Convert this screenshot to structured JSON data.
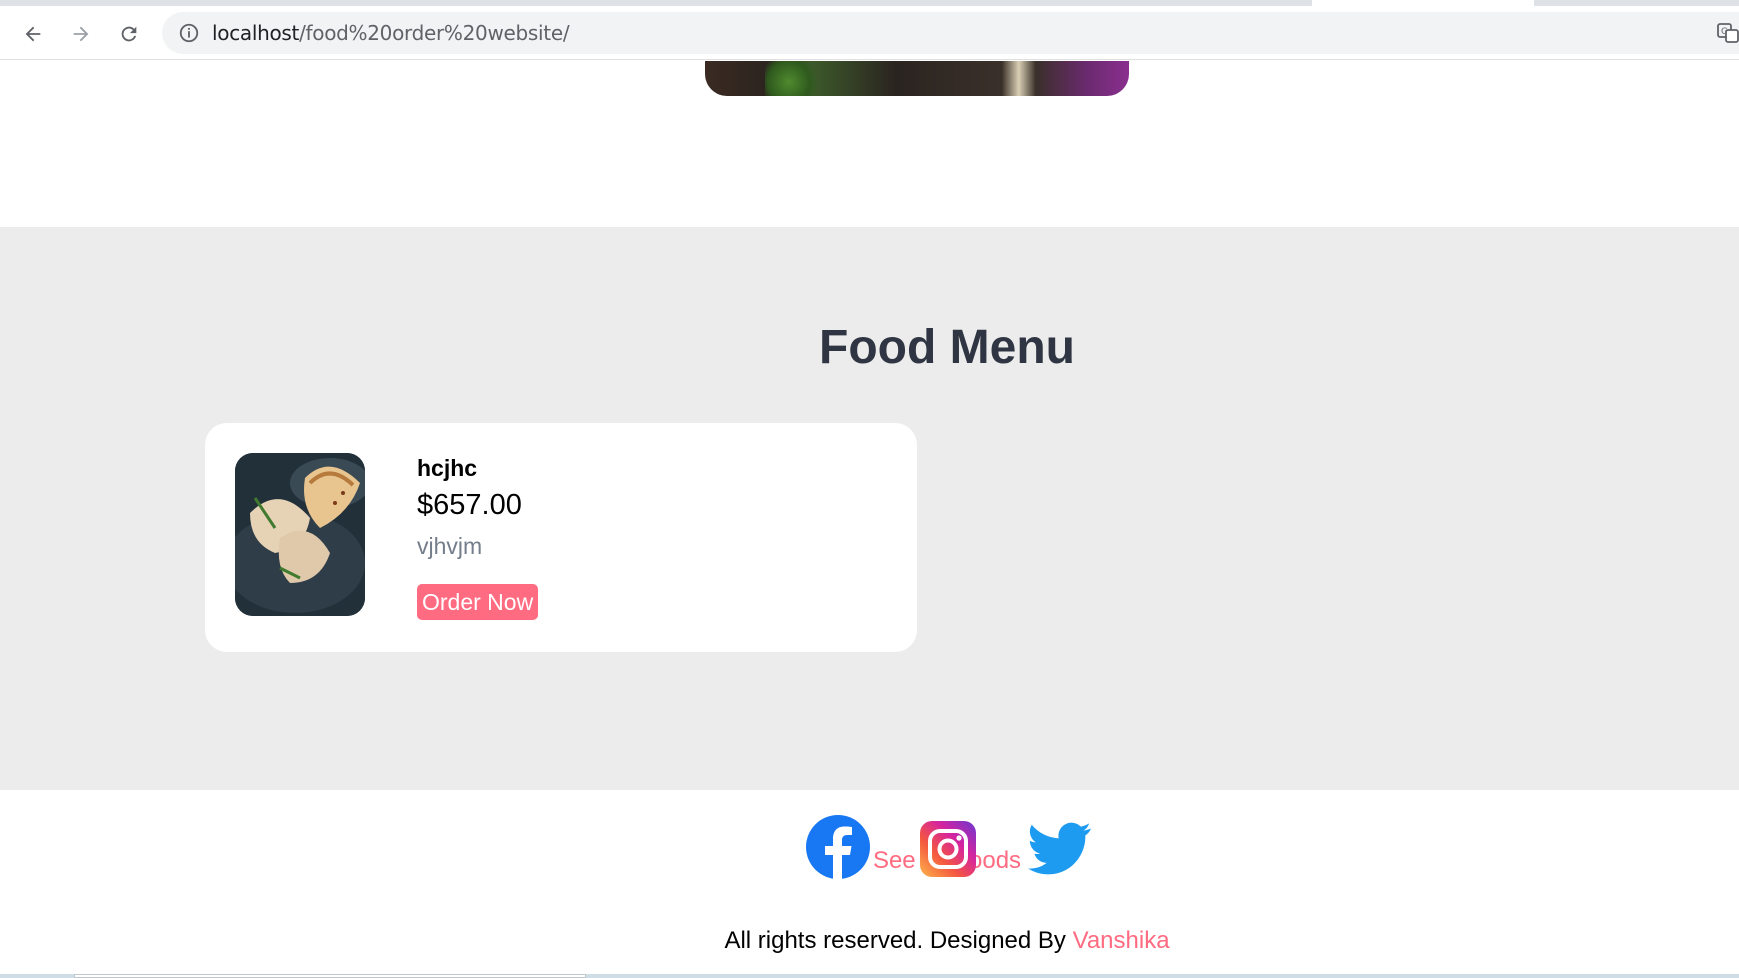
{
  "browser": {
    "url_host": "localhost",
    "url_path": "/food%20order%20website/"
  },
  "menu": {
    "title": "Food Menu",
    "items": [
      {
        "name": "hcjhc",
        "price": "$657.00",
        "description": "vjhvjm",
        "order_label": "Order Now"
      }
    ],
    "see_all_label": "See All Foods"
  },
  "social": {
    "icons": [
      "facebook-icon",
      "instagram-icon",
      "twitter-icon"
    ]
  },
  "footer": {
    "text": "All rights reserved. Designed By ",
    "author": "Vanshika"
  },
  "colors": {
    "accent": "#ff6b81",
    "title": "#2f3542",
    "section_bg": "#ececec",
    "muted": "#747d8c"
  }
}
